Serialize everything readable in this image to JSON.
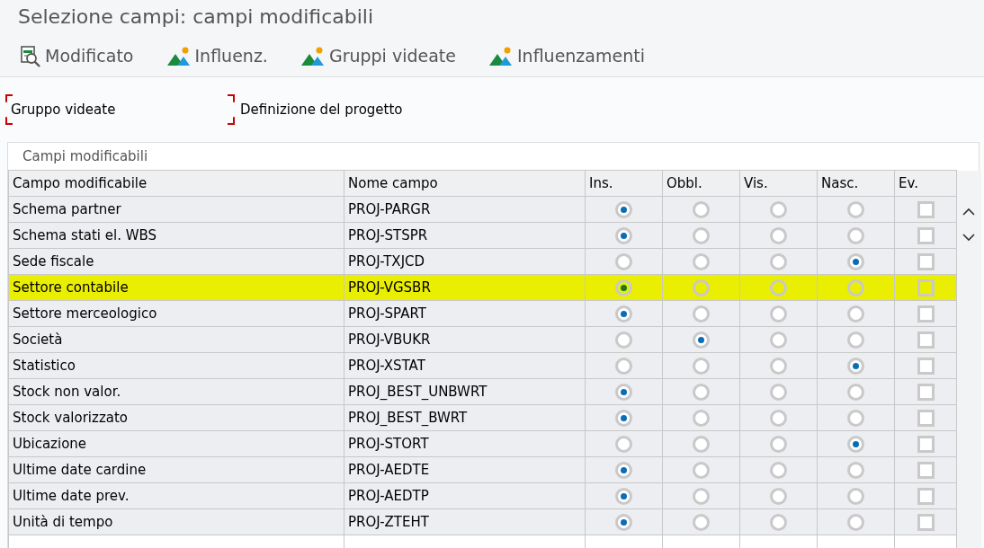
{
  "window": {
    "title": "Selezione campi: campi modificabili"
  },
  "toolbar": [
    {
      "label": "Modificato",
      "kind": "doc"
    },
    {
      "label": "Influenz.",
      "kind": "mountain"
    },
    {
      "label": "Gruppi videate",
      "kind": "mountain"
    },
    {
      "label": "Influenzamenti",
      "kind": "mountain"
    }
  ],
  "header_fields": [
    {
      "label": "Gruppo videate",
      "focused": true
    },
    {
      "label": "Definizione del progetto",
      "focused": false
    }
  ],
  "table": {
    "title": "Campi modificabili",
    "columns": [
      "Campo modificabile",
      "Nome campo",
      "Ins.",
      "Obbl.",
      "Vis.",
      "Nasc.",
      "Ev."
    ],
    "rows": [
      {
        "field": "Schema partner",
        "name": "PROJ-PARGR",
        "highlighted": false,
        "options": [
          true,
          false,
          false,
          false
        ],
        "ev": false
      },
      {
        "field": "Schema stati el. WBS",
        "name": "PROJ-STSPR",
        "highlighted": false,
        "options": [
          true,
          false,
          false,
          false
        ],
        "ev": false
      },
      {
        "field": "Sede fiscale",
        "name": "PROJ-TXJCD",
        "highlighted": false,
        "options": [
          false,
          false,
          false,
          true
        ],
        "ev": false
      },
      {
        "field": "Settore contabile",
        "name": "PROJ-VGSBR",
        "highlighted": true,
        "options": [
          true,
          false,
          false,
          false
        ],
        "ev": false
      },
      {
        "field": "Settore merceologico",
        "name": "PROJ-SPART",
        "highlighted": false,
        "options": [
          true,
          false,
          false,
          false
        ],
        "ev": false
      },
      {
        "field": "Società",
        "name": "PROJ-VBUKR",
        "highlighted": false,
        "options": [
          false,
          true,
          false,
          false
        ],
        "ev": false
      },
      {
        "field": "Statistico",
        "name": "PROJ-XSTAT",
        "highlighted": false,
        "options": [
          false,
          false,
          false,
          true
        ],
        "ev": false
      },
      {
        "field": "Stock non valor.",
        "name": "PROJ_BEST_UNBWRT",
        "highlighted": false,
        "options": [
          true,
          false,
          false,
          false
        ],
        "ev": false
      },
      {
        "field": "Stock valorizzato",
        "name": "PROJ_BEST_BWRT",
        "highlighted": false,
        "options": [
          true,
          false,
          false,
          false
        ],
        "ev": false
      },
      {
        "field": "Ubicazione",
        "name": "PROJ-STORT",
        "highlighted": false,
        "options": [
          false,
          false,
          false,
          true
        ],
        "ev": false
      },
      {
        "field": "Ultime date cardine",
        "name": "PROJ-AEDTE",
        "highlighted": false,
        "options": [
          true,
          false,
          false,
          false
        ],
        "ev": false
      },
      {
        "field": "Ultime date prev.",
        "name": "PROJ-AEDTP",
        "highlighted": false,
        "options": [
          true,
          false,
          false,
          false
        ],
        "ev": false
      },
      {
        "field": "Unità di tempo",
        "name": "PROJ-ZTEHT",
        "highlighted": false,
        "options": [
          true,
          false,
          false,
          false
        ],
        "ev": false
      }
    ]
  }
}
